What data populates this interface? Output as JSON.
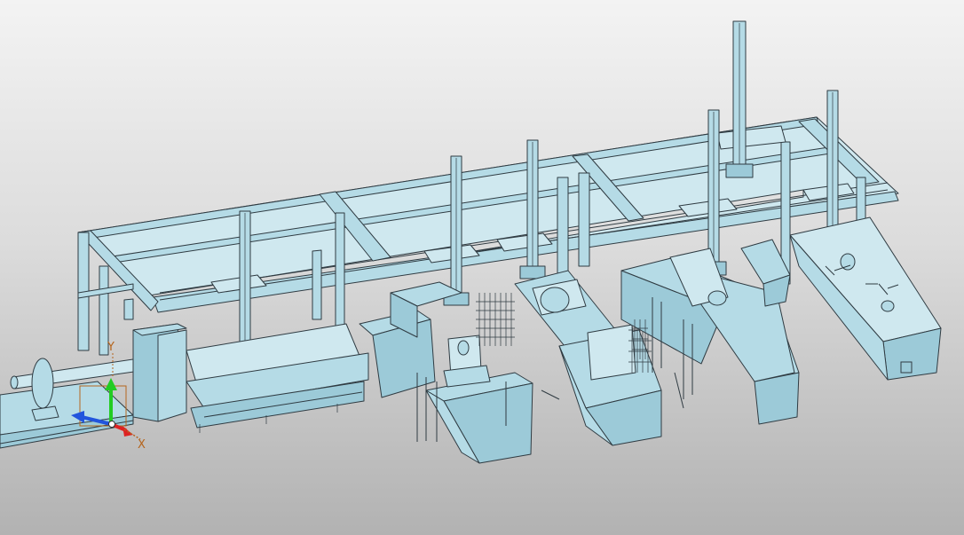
{
  "viewport": {
    "background_top": "#f3f3f3",
    "background_bottom": "#b2b2b2"
  },
  "model": {
    "part_fill": "#b5dbe6",
    "part_fill_dark": "#9ccad8",
    "edge_color": "#2f3b42",
    "gantry_count": 6,
    "machine_stations": 5
  },
  "triad": {
    "x_label": "X",
    "y_label": "Y",
    "z_color": "#2255dd",
    "y_color": "#22cc22",
    "x_color": "#dd2222",
    "label_color": "#b5651d"
  }
}
